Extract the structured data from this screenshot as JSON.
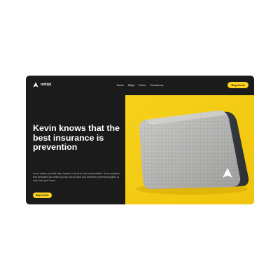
{
  "brand": {
    "name": "mitipi"
  },
  "nav": {
    "items": [
      "Kevin",
      "Mitipi",
      "Press",
      "Contact us"
    ]
  },
  "header": {
    "cta_label": "Buy Kevin"
  },
  "hero": {
    "title": "Kevin knows that the best insurance is prevention",
    "description": "Kevin makes your life safe, thanks to its all-in-one functionalities. Kevin replaces and simulates you while you are not at home and therefore prevents burglars to enter into your home.",
    "cta_label": "Buy Kevin"
  },
  "colors": {
    "accent": "#ffd21f",
    "background": "#1b1b1b",
    "image_background": "#f5cc12"
  },
  "icons": {
    "logo": "triangle-logo-icon",
    "device_logo": "triangle-logo-icon"
  }
}
